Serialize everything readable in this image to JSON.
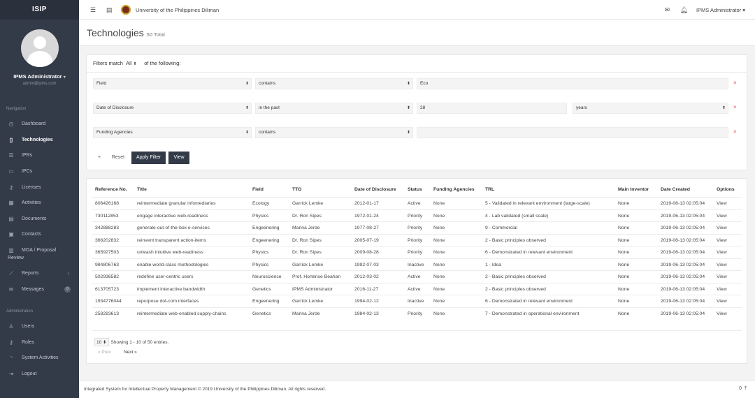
{
  "sidebar": {
    "brand": "ISIP",
    "user_name": "IPMS Administrator",
    "user_email": "admin@ipms.com",
    "nav_section": "Navigation",
    "admin_section": "Administration",
    "items": [
      {
        "label": "Dashboard",
        "icon": "dashboard-icon"
      },
      {
        "label": "Technologies",
        "icon": "book-icon"
      },
      {
        "label": "IPRs",
        "icon": "database-icon"
      },
      {
        "label": "IPCs",
        "icon": "folder-icon"
      },
      {
        "label": "Licenses",
        "icon": "key-icon"
      },
      {
        "label": "Activities",
        "icon": "calendar-icon"
      },
      {
        "label": "Documents",
        "icon": "document-icon"
      },
      {
        "label": "Contacts",
        "icon": "contact-icon"
      },
      {
        "label": "MOA / Proposal",
        "label2": "Review",
        "icon": "chart-icon"
      },
      {
        "label": "Reports",
        "icon": "trend-icon"
      },
      {
        "label": "Messages",
        "icon": "mail-icon",
        "badge": "0"
      }
    ],
    "admin_items": [
      {
        "label": "Users",
        "icon": "user-icon"
      },
      {
        "label": "Roles",
        "icon": "key-icon"
      },
      {
        "label": "System Activities",
        "icon": "rss-icon"
      },
      {
        "label": "Logout",
        "icon": "logout-icon"
      }
    ]
  },
  "topbar": {
    "university": "University of the Philippines Diliman",
    "user": "IPMS Administrator"
  },
  "page": {
    "title": "Technologies",
    "total": "50 Total"
  },
  "filters": {
    "match_prefix": "Filters match",
    "match_value": "All",
    "match_suffix": "of the following:",
    "rows": [
      {
        "field": "Field",
        "operator": "contains",
        "value": "Eco",
        "unit": ""
      },
      {
        "field": "Date of Disclosure",
        "operator": "in the past",
        "value": "28",
        "unit": "years"
      },
      {
        "field": "Funding Agencies",
        "operator": "contains",
        "value": "",
        "unit": ""
      }
    ],
    "add_label": "+",
    "reset_label": "Reset",
    "apply_label": "Apply Filter",
    "view_label": "View"
  },
  "table": {
    "headers": [
      "Reference No.",
      "Title",
      "Field",
      "TTO",
      "Date of Disclosure",
      "Status",
      "Funding Agencies",
      "TRL",
      "Main Inventor",
      "Date Created",
      "Options"
    ],
    "rows": [
      [
        "806426168",
        "reintermediate granular infomediaries",
        "Ecology",
        "Garrick Lemke",
        "2012-01-17",
        "Active",
        "None",
        "5 - Validated in relevant environment (large-scale)",
        "None",
        "2019-06-13 02:05:04",
        "View"
      ],
      [
        "730112853",
        "engage interactive web-readiness",
        "Physics",
        "Dr. Ron Sipes",
        "1972-01-24",
        "Priority",
        "None",
        "4 - Lab validated (small scale)",
        "None",
        "2019-06-13 02:05:04",
        "View"
      ],
      [
        "342888283",
        "generate out-of-the-box e-services",
        "Engeenering",
        "Marina Jerde",
        "1977-08-27",
        "Priority",
        "None",
        "9 - Commercial",
        "None",
        "2019-06-13 02:05:04",
        "View"
      ],
      [
        "366202832",
        "reinvent transparent action-items",
        "Engeenering",
        "Dr. Ron Sipes",
        "2005-07-19",
        "Priority",
        "None",
        "2 - Basic principles observed",
        "None",
        "2019-06-13 02:05:04",
        "View"
      ],
      [
        "365927503",
        "unleash intuitive web-readiness",
        "Physics",
        "Dr. Ron Sipes",
        "2009-08-28",
        "Priority",
        "None",
        "6 - Demonstrated in relevant environment",
        "None",
        "2019-06-13 02:05:04",
        "View"
      ],
      [
        "984806763",
        "enable world-class methodologies",
        "Physics",
        "Garrick Lemke",
        "1992-07-03",
        "Inactive",
        "None",
        "1 - Idea",
        "None",
        "2019-06-13 02:05:04",
        "View"
      ],
      [
        "502936582",
        "redefine user-centric users",
        "Neuroscience",
        "Prof. Hortense Beahan",
        "2012-03-02",
        "Active",
        "None",
        "2 - Basic principles observed",
        "None",
        "2019-06-13 02:05:04",
        "View"
      ],
      [
        "613705723",
        "implement interactive bandwidth",
        "Genetics",
        "IPMS Administrator",
        "2016-11-27",
        "Active",
        "None",
        "2 - Basic principles observed",
        "None",
        "2019-06-13 02:05:04",
        "View"
      ],
      [
        "1934776044",
        "repurpose dot-com interfaces",
        "Engeenering",
        "Garrick Lemke",
        "1994-02-12",
        "Inactive",
        "None",
        "6 - Demonstrated in relevant environment",
        "None",
        "2019-06-13 02:05:04",
        "View"
      ],
      [
        "258283613",
        "reintermediate web-enabled supply-chains",
        "Genetics",
        "Marina Jerde",
        "1984-02-13",
        "Priority",
        "None",
        "7 - Demonstrated in operational environment",
        "None",
        "2019-06-13 02:05:04",
        "View"
      ]
    ],
    "page_size": "10",
    "showing": "Showing 1 - 10 of 50 entries.",
    "prev_label": "« Prev",
    "next_label": "Next »"
  },
  "footer": {
    "text": "Integrated System for Intellectual Property Management © 2019 University of the Philippines Diliman. All rights reserved.",
    "right": "0"
  }
}
